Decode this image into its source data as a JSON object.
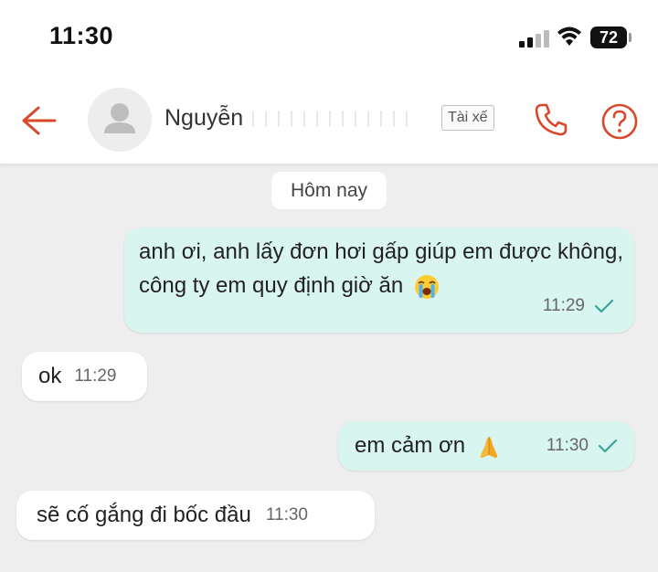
{
  "status_bar": {
    "time": "11:30",
    "battery": "72"
  },
  "header": {
    "contact_name": "Nguyễn",
    "role_tag": "Tài xế"
  },
  "chat": {
    "date_label": "Hôm nay",
    "messages": [
      {
        "direction": "outgoing",
        "text": "anh ơi, anh lấy đơn hơi gấp giúp em được không, công ty em quy định giờ ăn",
        "emoji": "loudly-crying-face",
        "time": "11:29",
        "status": "sent"
      },
      {
        "direction": "incoming",
        "text": "ok",
        "time": "11:29"
      },
      {
        "direction": "outgoing",
        "text": "em cảm ơn",
        "emoji": "folded-hands",
        "time": "11:30",
        "status": "sent"
      },
      {
        "direction": "incoming",
        "text": "sẽ cố gắng đi bốc đầu",
        "time": "11:30"
      }
    ]
  },
  "colors": {
    "accent": "#d9482b",
    "outgoing_bubble": "#d8f5ef",
    "incoming_bubble": "#ffffff",
    "chat_background": "#eeeeee",
    "check": "#3aa39a"
  }
}
